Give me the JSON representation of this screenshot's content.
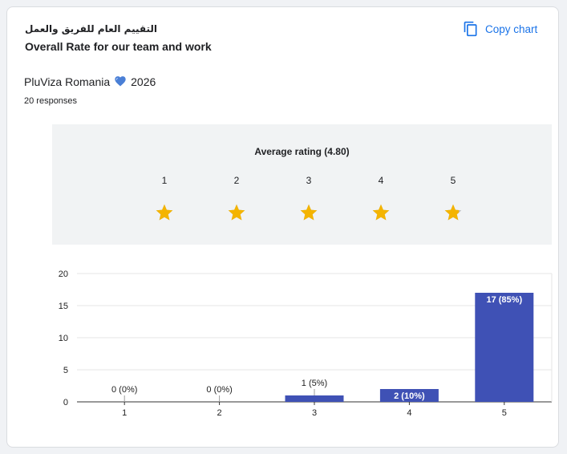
{
  "question": {
    "title_arabic": "التقييم العام للفريق والعمل",
    "title_english": "Overall Rate for our team and work"
  },
  "copy_chart": {
    "label": "Copy chart",
    "icon": "copy-icon"
  },
  "form": {
    "name": "PluViza Romania",
    "heart_icon": "blue-heart-icon",
    "year": "2026",
    "responses": "20 responses"
  },
  "rating_summary": {
    "label": "Average rating (4.80)",
    "average": 4.8,
    "scale": [
      "1",
      "2",
      "3",
      "4",
      "5"
    ]
  },
  "colors": {
    "bar": "#3f51b5",
    "star": "#f4b400",
    "star_empty": "#bdbdbd",
    "accent": "#1a73e8"
  },
  "chart_data": {
    "type": "bar",
    "categories": [
      "1",
      "2",
      "3",
      "4",
      "5"
    ],
    "values": [
      0,
      0,
      1,
      2,
      17
    ],
    "data_labels": [
      "0 (0%)",
      "0 (0%)",
      "1 (5%)",
      "2 (10%)",
      "17 (85%)"
    ],
    "yticks": [
      "0",
      "5",
      "10",
      "15",
      "20"
    ],
    "ylim": [
      0,
      20
    ],
    "grid": true,
    "title": "",
    "xlabel": "",
    "ylabel": ""
  }
}
